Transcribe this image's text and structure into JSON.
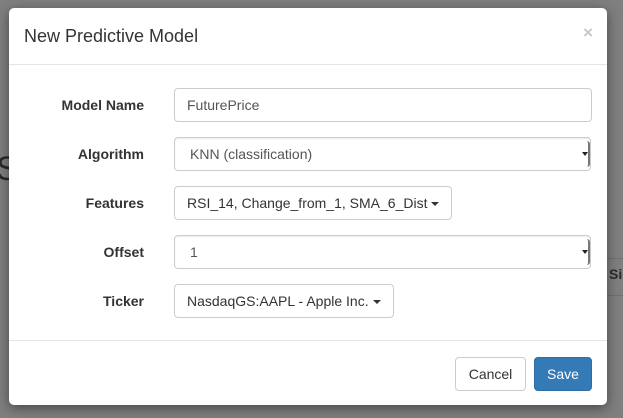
{
  "modal": {
    "title": "New Predictive Model",
    "close_label": "×"
  },
  "form": {
    "model_name": {
      "label": "Model Name",
      "value": "FuturePrice"
    },
    "algorithm": {
      "label": "Algorithm",
      "value": "KNN (classification)"
    },
    "features": {
      "label": "Features",
      "value": "RSI_14, Change_from_1, SMA_6_Dist"
    },
    "offset": {
      "label": "Offset",
      "value": "1"
    },
    "ticker": {
      "label": "Ticker",
      "value": "NasdaqGS:AAPL - Apple Inc."
    }
  },
  "footer": {
    "cancel_label": "Cancel",
    "save_label": "Save"
  },
  "background": {
    "left_fragment": "S",
    "right_fragment": "Si"
  },
  "colors": {
    "primary": "#337ab7",
    "backdrop": "#7f7f7f"
  }
}
